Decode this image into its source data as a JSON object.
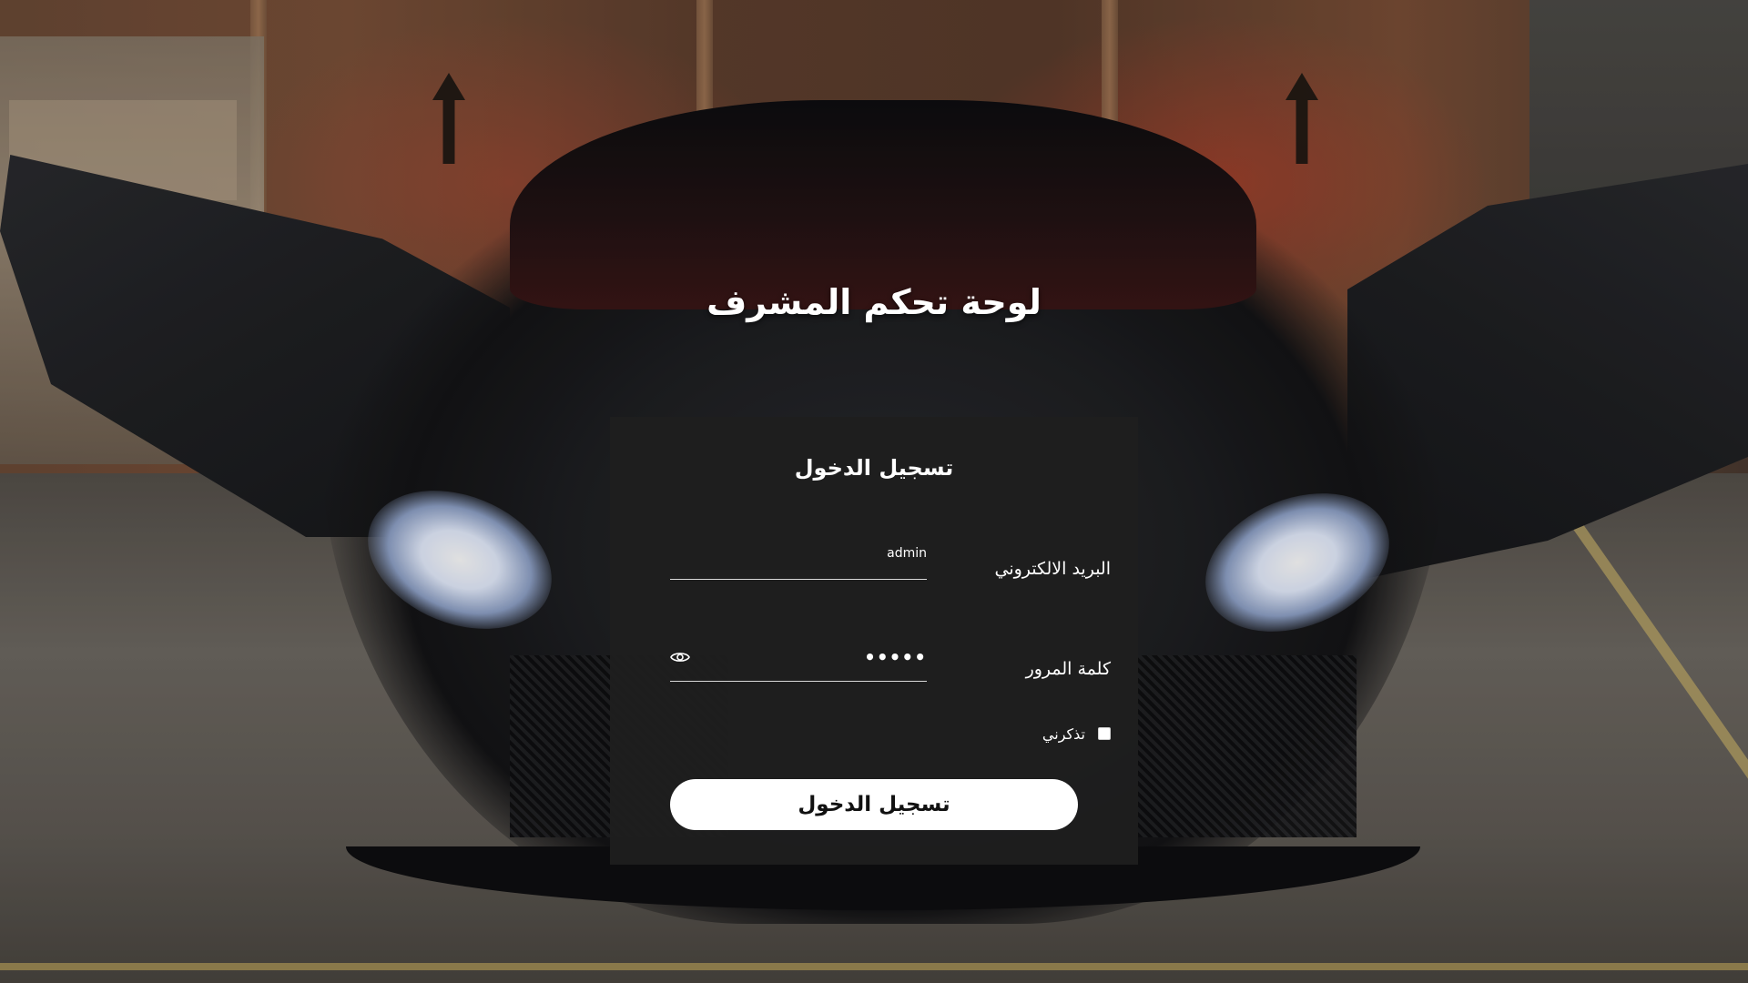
{
  "page": {
    "title": "لوحة تحكم المشرف"
  },
  "login_card": {
    "title": "تسجيل الدخول",
    "email_label": "البريد الالكتروني",
    "email_value": "admin",
    "password_label": "كلمة المرور",
    "password_value": "•••••",
    "remember_label": "تذكرني",
    "remember_checked": false,
    "submit_label": "تسجيل الدخول"
  },
  "icons": {
    "password_toggle": "eye-icon"
  },
  "colors": {
    "card_background": "#1e1e1e",
    "button_background": "#ffffff",
    "button_text": "#111111",
    "text": "#ffffff"
  }
}
